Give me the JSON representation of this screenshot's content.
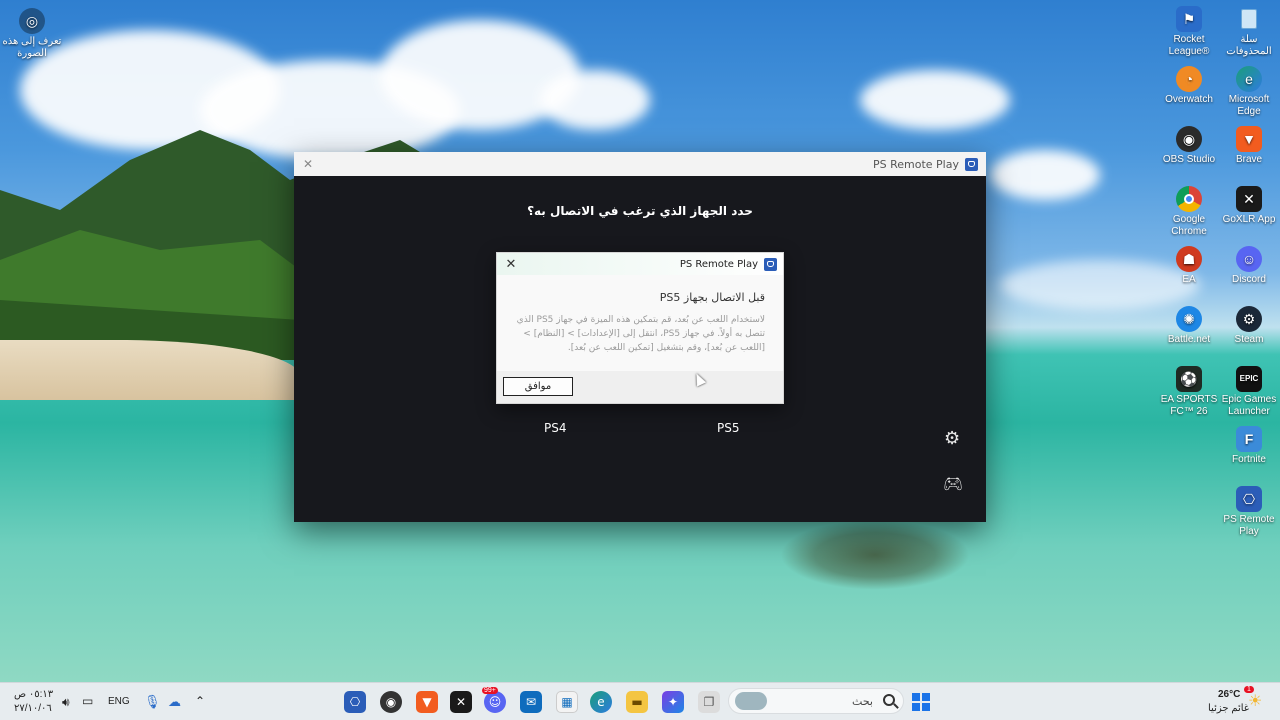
{
  "desktop": {
    "icons_left": [
      {
        "label": "تعرف إلى هذه الصورة",
        "icon": "camera-icon"
      }
    ],
    "icons_right_col1": [
      {
        "label": "Rocket League®",
        "icon": "rocket-league-icon",
        "color": "#2a6cc9"
      },
      {
        "label": "Overwatch",
        "icon": "overwatch-icon",
        "color": "#f08a24"
      },
      {
        "label": "OBS Studio",
        "icon": "obs-icon",
        "color": "#2b2b2b"
      },
      {
        "label": "Google Chrome",
        "icon": "chrome-icon",
        "color": "#db4437"
      },
      {
        "label": "EA",
        "icon": "ea-icon",
        "color": "#d03a1f"
      },
      {
        "label": "Battle.net",
        "icon": "battlenet-icon",
        "color": "#1e87e5"
      },
      {
        "label": "EA SPORTS FC™ 26",
        "icon": "ea-fc-icon",
        "color": "#1f2a24"
      }
    ],
    "icons_right_col2": [
      {
        "label": "سلة المحذوفات",
        "icon": "recycle-bin-icon",
        "color": "#6aa7d8"
      },
      {
        "label": "Microsoft Edge",
        "icon": "edge-icon",
        "color": "#1a9e7a"
      },
      {
        "label": "Brave",
        "icon": "brave-icon",
        "color": "#f25c1f"
      },
      {
        "label": "GoXLR App",
        "icon": "goxlr-icon",
        "color": "#1a1a1a"
      },
      {
        "label": "Discord",
        "icon": "discord-icon",
        "color": "#5865f2"
      },
      {
        "label": "Steam",
        "icon": "steam-icon",
        "color": "#1b2838"
      },
      {
        "label": "Epic Games Launcher",
        "icon": "epic-games-icon",
        "color": "#111111"
      },
      {
        "label": "Fortnite",
        "icon": "fortnite-icon",
        "color": "#3b8bd9"
      },
      {
        "label": "PS Remote Play",
        "icon": "ps-remote-play-icon",
        "color": "#2b5db8"
      }
    ]
  },
  "main_window": {
    "title": "PS Remote Play",
    "prompt": "حدد الجهاز الذي ترغب في الاتصال به؟",
    "devices": [
      "PS4",
      "PS5"
    ]
  },
  "dialog": {
    "title": "PS Remote Play",
    "heading": "قبل الاتصال بجهاز PS5",
    "body": "لاستخدام اللعب عن بُعد، قم بتمكين هذه الميزة في جهاز PS5 الذي تتصل به أولاً. في جهاز PS5، انتقل إلى [الإعدادات] > [النظام] > [اللعب عن بُعد]، وقم بتشغيل [تمكين اللعب عن بُعد].",
    "ok_label": "موافق"
  },
  "taskbar": {
    "clock_time": "٠٥:١٣ ص",
    "clock_date": "٢٧/١٠/٠٦",
    "language": "ENG",
    "search_placeholder": "بحث",
    "weather_temp": "26°C",
    "weather_desc": "غائم جزئيا",
    "notification_count": "1",
    "discord_badge": "99+"
  },
  "colors": {
    "accent": "#2b5db8",
    "window_bg": "#17181d",
    "taskbar_bg": "#e7ecef"
  }
}
